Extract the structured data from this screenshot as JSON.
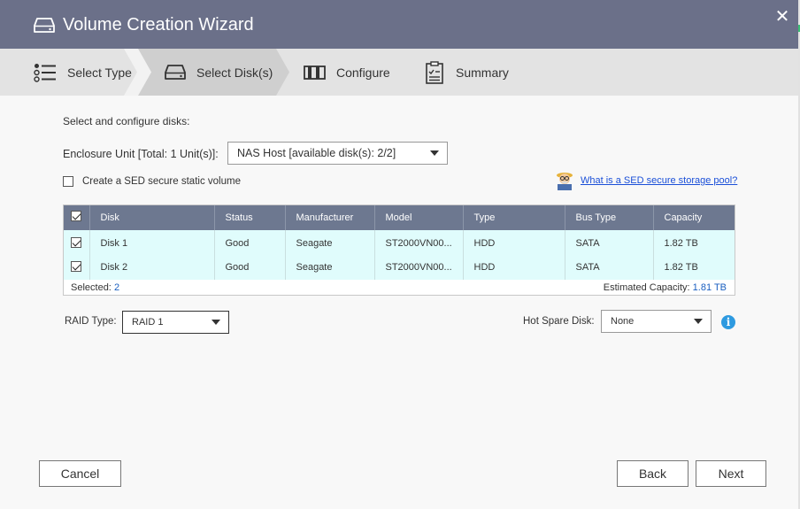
{
  "window": {
    "title": "Volume Creation Wizard",
    "close_glyph": "✕"
  },
  "steps": [
    {
      "label": "Select Type",
      "icon": "list-bullets-icon",
      "active": false
    },
    {
      "label": "Select Disk(s)",
      "icon": "hard-drive-icon",
      "active": true
    },
    {
      "label": "Configure",
      "icon": "configure-icon",
      "active": false
    },
    {
      "label": "Summary",
      "icon": "clipboard-icon",
      "active": false
    }
  ],
  "main": {
    "heading": "Select and configure disks:",
    "enclosure_label": "Enclosure Unit [Total: 1 Unit(s)]:",
    "enclosure_value": "NAS Host [available disk(s): 2/2]",
    "sed_checkbox_label": "Create a SED secure static volume",
    "sed_checked": false,
    "help_link": "What is a SED secure storage pool?"
  },
  "table": {
    "columns": [
      "Disk",
      "Status",
      "Manufacturer",
      "Model",
      "Type",
      "Bus Type",
      "Capacity"
    ],
    "rows": [
      {
        "checked": true,
        "disk": "Disk 1",
        "status": "Good",
        "manufacturer": "Seagate",
        "model": "ST2000VN00...",
        "type": "HDD",
        "bus": "SATA",
        "capacity": "1.82 TB"
      },
      {
        "checked": true,
        "disk": "Disk 2",
        "status": "Good",
        "manufacturer": "Seagate",
        "model": "ST2000VN00...",
        "type": "HDD",
        "bus": "SATA",
        "capacity": "1.82 TB"
      }
    ],
    "selected_label": "Selected:",
    "selected_count": "2",
    "estimated_label": "Estimated Capacity:",
    "estimated_value": "1.81 TB"
  },
  "raid": {
    "label": "RAID Type:",
    "value": "RAID 1"
  },
  "hot_spare": {
    "label": "Hot Spare Disk:",
    "value": "None",
    "info_glyph": "i"
  },
  "buttons": {
    "cancel": "Cancel",
    "back": "Back",
    "next": "Next"
  },
  "colors": {
    "titlebar": "#6b7089",
    "table_header": "#6d7890",
    "row_bg": "#e0fcfc",
    "link": "#1a4fd8",
    "info": "#2e9ae0"
  }
}
